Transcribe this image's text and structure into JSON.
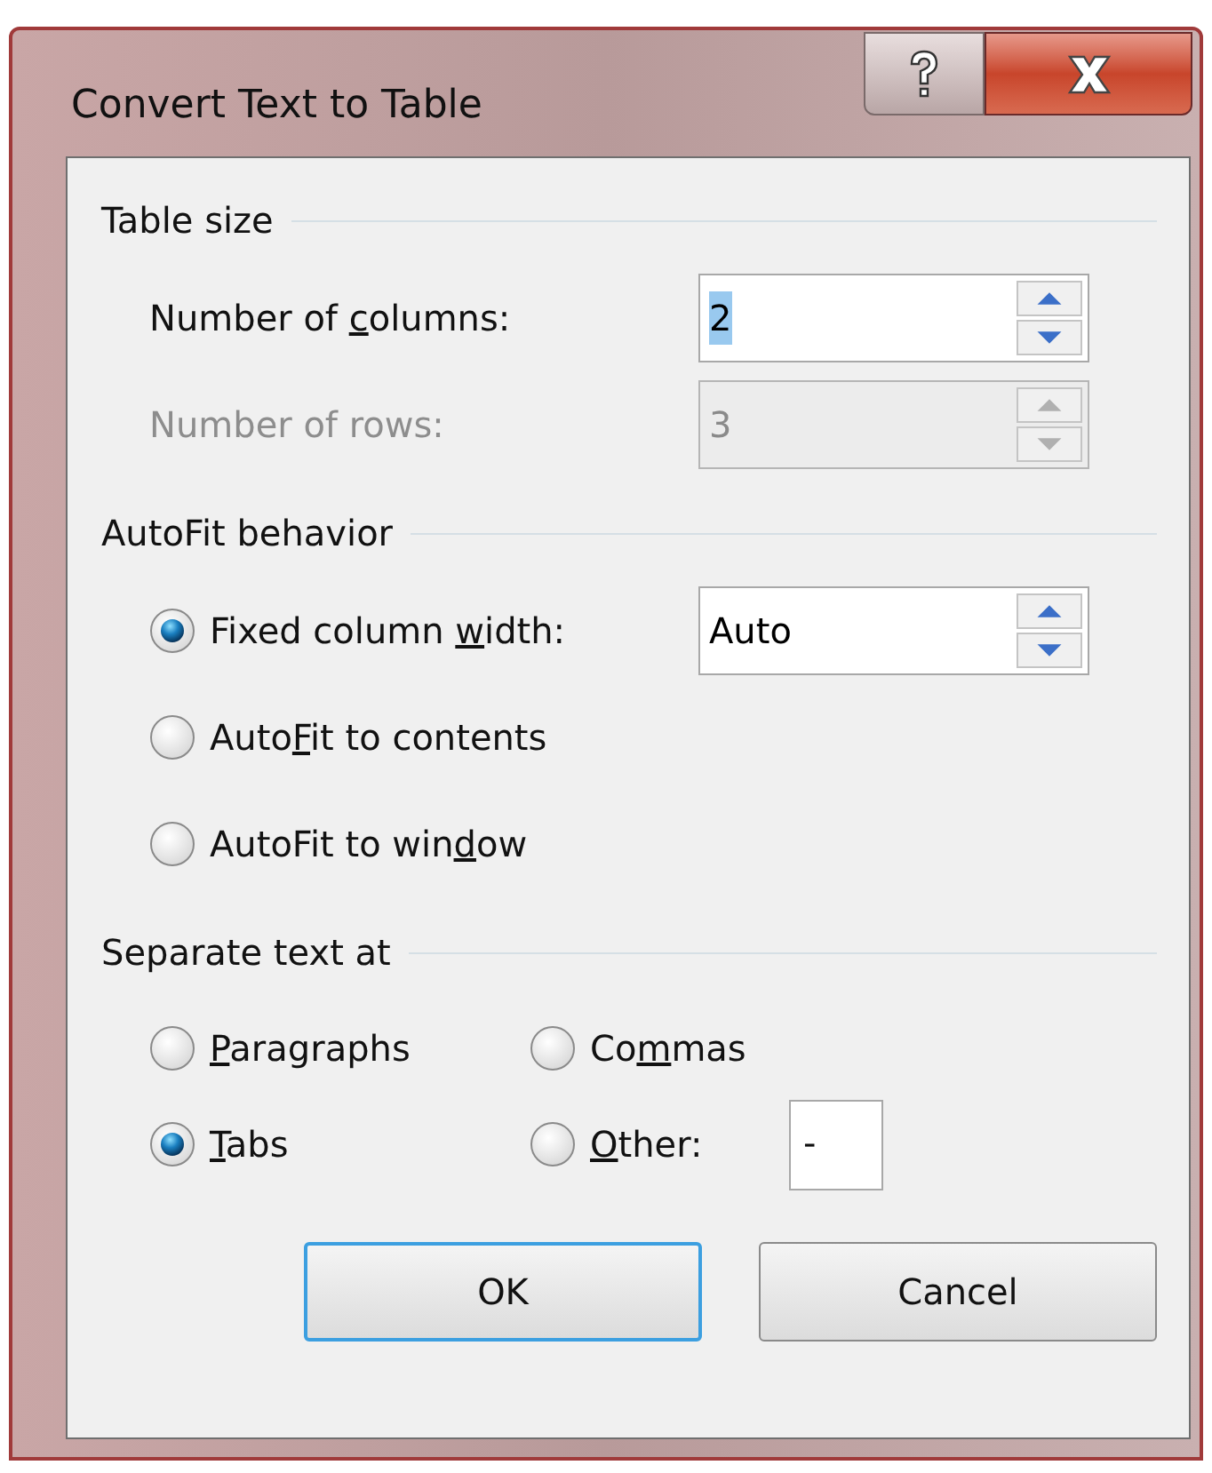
{
  "window": {
    "title": "Convert Text to Table"
  },
  "sections": [
    {
      "title": "Table size",
      "kind": "rows",
      "rows": [
        {
          "kind": "spinner",
          "label": {
            "pre": "Number of ",
            "key": "c",
            "post": "olumns:"
          },
          "value": "2",
          "value_selected": true,
          "disabled": false
        },
        {
          "kind": "spinner",
          "label": {
            "pre": "Number of rows:"
          },
          "value": "3",
          "value_selected": false,
          "disabled": true
        }
      ]
    },
    {
      "title": "AutoFit behavior",
      "kind": "rows",
      "rows": [
        {
          "kind": "radio_spinner",
          "label": {
            "pre": "Fixed column ",
            "key": "w",
            "post": "idth:"
          },
          "selected": true,
          "value": "Auto"
        },
        {
          "kind": "radio",
          "label": {
            "pre": "Auto",
            "key": "F",
            "post": "it to contents"
          },
          "selected": false
        },
        {
          "kind": "radio",
          "label": {
            "pre": "AutoFit to win",
            "key": "d",
            "post": "ow"
          },
          "selected": false
        }
      ]
    },
    {
      "title": "Separate text at",
      "kind": "grid",
      "options": [
        {
          "label": {
            "key": "P",
            "post": "aragraphs"
          },
          "selected": false
        },
        {
          "label": {
            "pre": "Co",
            "key": "m",
            "post": "mas"
          },
          "selected": false
        },
        {
          "label": {
            "key": "T",
            "post": "abs"
          },
          "selected": true
        },
        {
          "label": {
            "key": "O",
            "post": "ther:"
          },
          "selected": false,
          "value": "-"
        }
      ]
    }
  ],
  "buttons": [
    {
      "label": "OK",
      "default": true
    },
    {
      "label": "Cancel",
      "default": false
    }
  ]
}
